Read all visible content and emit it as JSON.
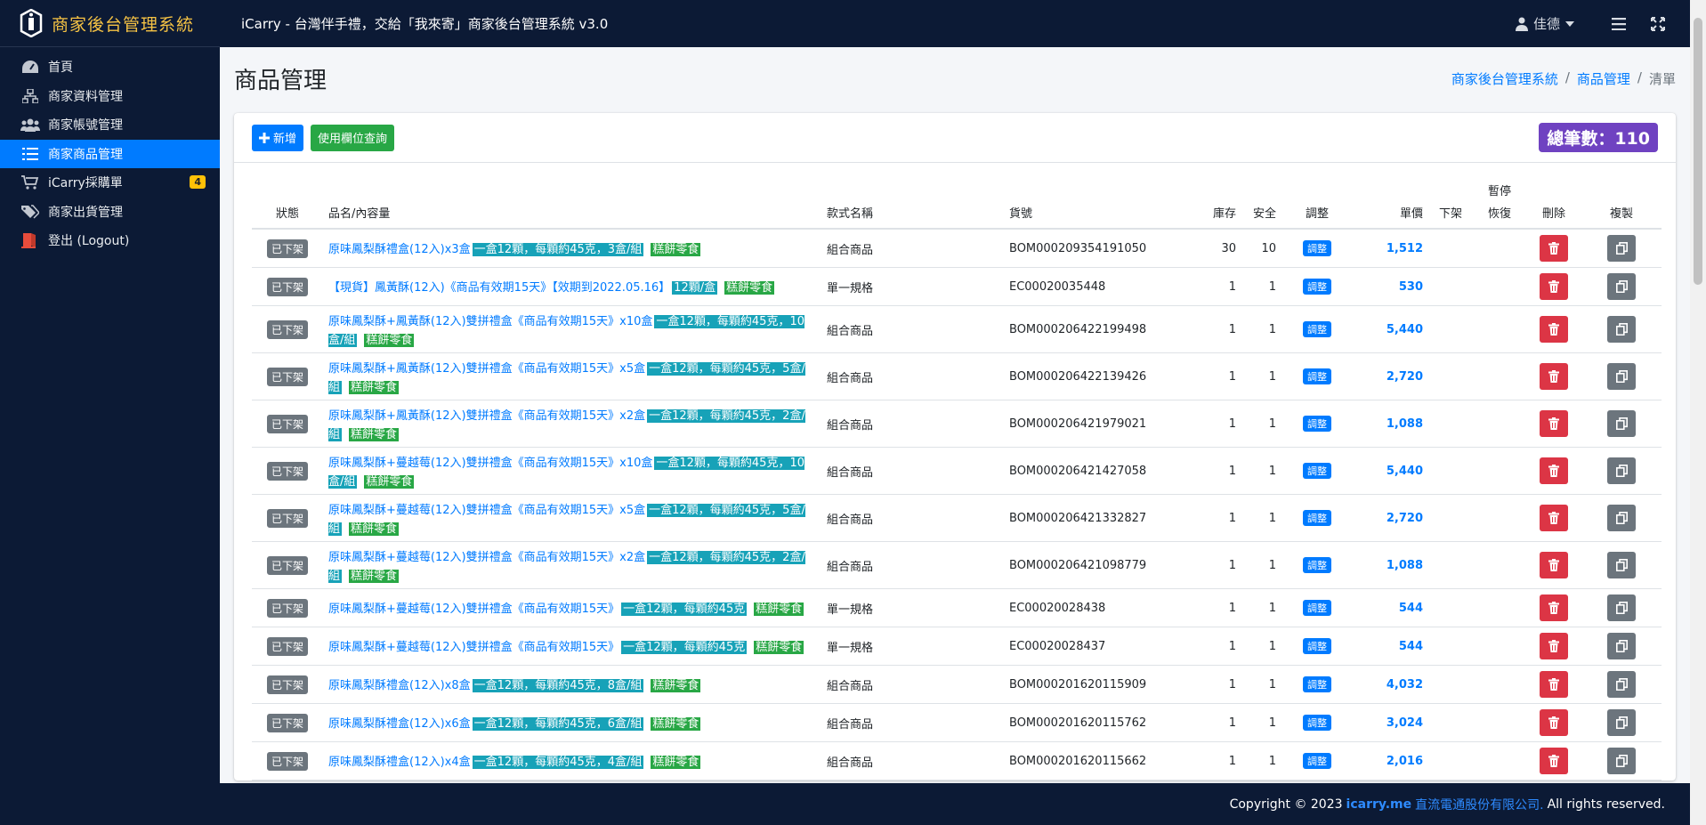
{
  "sidebar": {
    "brand": "商家後台管理系統",
    "items": [
      {
        "label": "首頁",
        "icon": "dashboard-icon"
      },
      {
        "label": "商家資料管理",
        "icon": "sitemap-icon"
      },
      {
        "label": "商家帳號管理",
        "icon": "users-icon"
      },
      {
        "label": "商家商品管理",
        "icon": "list-icon",
        "active": true
      },
      {
        "label": "iCarry採購單",
        "icon": "cart-icon",
        "badge": "4"
      },
      {
        "label": "商家出貨管理",
        "icon": "tags-icon"
      },
      {
        "label": "登出 (Logout)",
        "icon": "logout-icon"
      }
    ]
  },
  "topbar": {
    "title": "iCarry - 台灣伴手禮，交給「我來寄」商家後台管理系統 v3.0",
    "user": "佳德"
  },
  "page": {
    "title": "商品管理",
    "breadcrumb": [
      "商家後台管理系統",
      "商品管理",
      "清單"
    ]
  },
  "toolbar": {
    "add_label": "新增",
    "query_label": "使用欄位查詢",
    "total_label": "總筆數：110"
  },
  "table": {
    "headers": {
      "status": "狀態",
      "name": "品名/內容量",
      "style": "款式名稱",
      "sku": "貨號",
      "stock": "庫存",
      "safety": "安全",
      "adjust": "調整",
      "price": "單價",
      "offshelf": "下架",
      "pause1": "暫停",
      "pause2": "恢復",
      "delete": "刪除",
      "copy": "複製"
    },
    "rows": [
      {
        "status": "已下架",
        "name": "原味鳳梨酥禮盒(12入)x3盒",
        "spec": "一盒12顆，每顆約45克，3盒/組",
        "tag": "糕餅零食",
        "style": "組合商品",
        "sku": "BOM000209354191050",
        "stock": "30",
        "safety": "10",
        "adjust": "調整",
        "price": "1,512"
      },
      {
        "status": "已下架",
        "name": "【現貨】鳳黃酥(12入)《商品有效期15天》【效期到2022.05.16】",
        "spec": "12顆/盒",
        "tag": "糕餅零食",
        "style": "單一規格",
        "sku": "EC00020035448",
        "stock": "1",
        "safety": "1",
        "adjust": "調整",
        "price": "530"
      },
      {
        "status": "已下架",
        "name": "原味鳳梨酥+鳳黃酥(12入)雙拼禮盒《商品有效期15天》x10盒",
        "spec": "一盒12顆，每顆約45克，10盒/組",
        "tag": "糕餅零食",
        "style": "組合商品",
        "sku": "BOM000206422199498",
        "stock": "1",
        "safety": "1",
        "adjust": "調整",
        "price": "5,440"
      },
      {
        "status": "已下架",
        "name": "原味鳳梨酥+鳳黃酥(12入)雙拼禮盒《商品有效期15天》x5盒",
        "spec": "一盒12顆，每顆約45克，5盒/組",
        "tag": "糕餅零食",
        "style": "組合商品",
        "sku": "BOM000206422139426",
        "stock": "1",
        "safety": "1",
        "adjust": "調整",
        "price": "2,720"
      },
      {
        "status": "已下架",
        "name": "原味鳳梨酥+鳳黃酥(12入)雙拼禮盒《商品有效期15天》x2盒",
        "spec": "一盒12顆，每顆約45克，2盒/組",
        "tag": "糕餅零食",
        "style": "組合商品",
        "sku": "BOM000206421979021",
        "stock": "1",
        "safety": "1",
        "adjust": "調整",
        "price": "1,088"
      },
      {
        "status": "已下架",
        "name": "原味鳳梨酥+蔓越莓(12入)雙拼禮盒《商品有效期15天》x10盒",
        "spec": "一盒12顆，每顆約45克，10盒/組",
        "tag": "糕餅零食",
        "style": "組合商品",
        "sku": "BOM000206421427058",
        "stock": "1",
        "safety": "1",
        "adjust": "調整",
        "price": "5,440"
      },
      {
        "status": "已下架",
        "name": "原味鳳梨酥+蔓越莓(12入)雙拼禮盒《商品有效期15天》x5盒",
        "spec": "一盒12顆，每顆約45克，5盒/組",
        "tag": "糕餅零食",
        "style": "組合商品",
        "sku": "BOM000206421332827",
        "stock": "1",
        "safety": "1",
        "adjust": "調整",
        "price": "2,720"
      },
      {
        "status": "已下架",
        "name": "原味鳳梨酥+蔓越莓(12入)雙拼禮盒《商品有效期15天》x2盒",
        "spec": "一盒12顆，每顆約45克，2盒/組",
        "tag": "糕餅零食",
        "style": "組合商品",
        "sku": "BOM000206421098779",
        "stock": "1",
        "safety": "1",
        "adjust": "調整",
        "price": "1,088"
      },
      {
        "status": "已下架",
        "name": "原味鳳梨酥+蔓越莓(12入)雙拼禮盒《商品有效期15天》",
        "spec": "一盒12顆，每顆約45克",
        "tag": "糕餅零食",
        "style": "單一規格",
        "sku": "EC00020028438",
        "stock": "1",
        "safety": "1",
        "adjust": "調整",
        "price": "544"
      },
      {
        "status": "已下架",
        "name": "原味鳳梨酥+蔓越莓(12入)雙拼禮盒《商品有效期15天》",
        "spec": "一盒12顆，每顆約45克",
        "tag": "糕餅零食",
        "style": "單一規格",
        "sku": "EC00020028437",
        "stock": "1",
        "safety": "1",
        "adjust": "調整",
        "price": "544"
      },
      {
        "status": "已下架",
        "name": "原味鳳梨酥禮盒(12入)x8盒",
        "spec": "一盒12顆，每顆約45克，8盒/組",
        "tag": "糕餅零食",
        "style": "組合商品",
        "sku": "BOM000201620115909",
        "stock": "1",
        "safety": "1",
        "adjust": "調整",
        "price": "4,032"
      },
      {
        "status": "已下架",
        "name": "原味鳳梨酥禮盒(12入)x6盒",
        "spec": "一盒12顆，每顆約45克，6盒/組",
        "tag": "糕餅零食",
        "style": "組合商品",
        "sku": "BOM000201620115762",
        "stock": "1",
        "safety": "1",
        "adjust": "調整",
        "price": "3,024"
      },
      {
        "status": "已下架",
        "name": "原味鳳梨酥禮盒(12入)x4盒",
        "spec": "一盒12顆，每顆約45克，4盒/組",
        "tag": "糕餅零食",
        "style": "組合商品",
        "sku": "BOM000201620115662",
        "stock": "1",
        "safety": "1",
        "adjust": "調整",
        "price": "2,016"
      }
    ]
  },
  "footer": {
    "prefix": "Copyright © 2023",
    "link1": "icarry.me",
    "link2": "直流電通股份有限公司.",
    "suffix": "All rights reserved."
  }
}
